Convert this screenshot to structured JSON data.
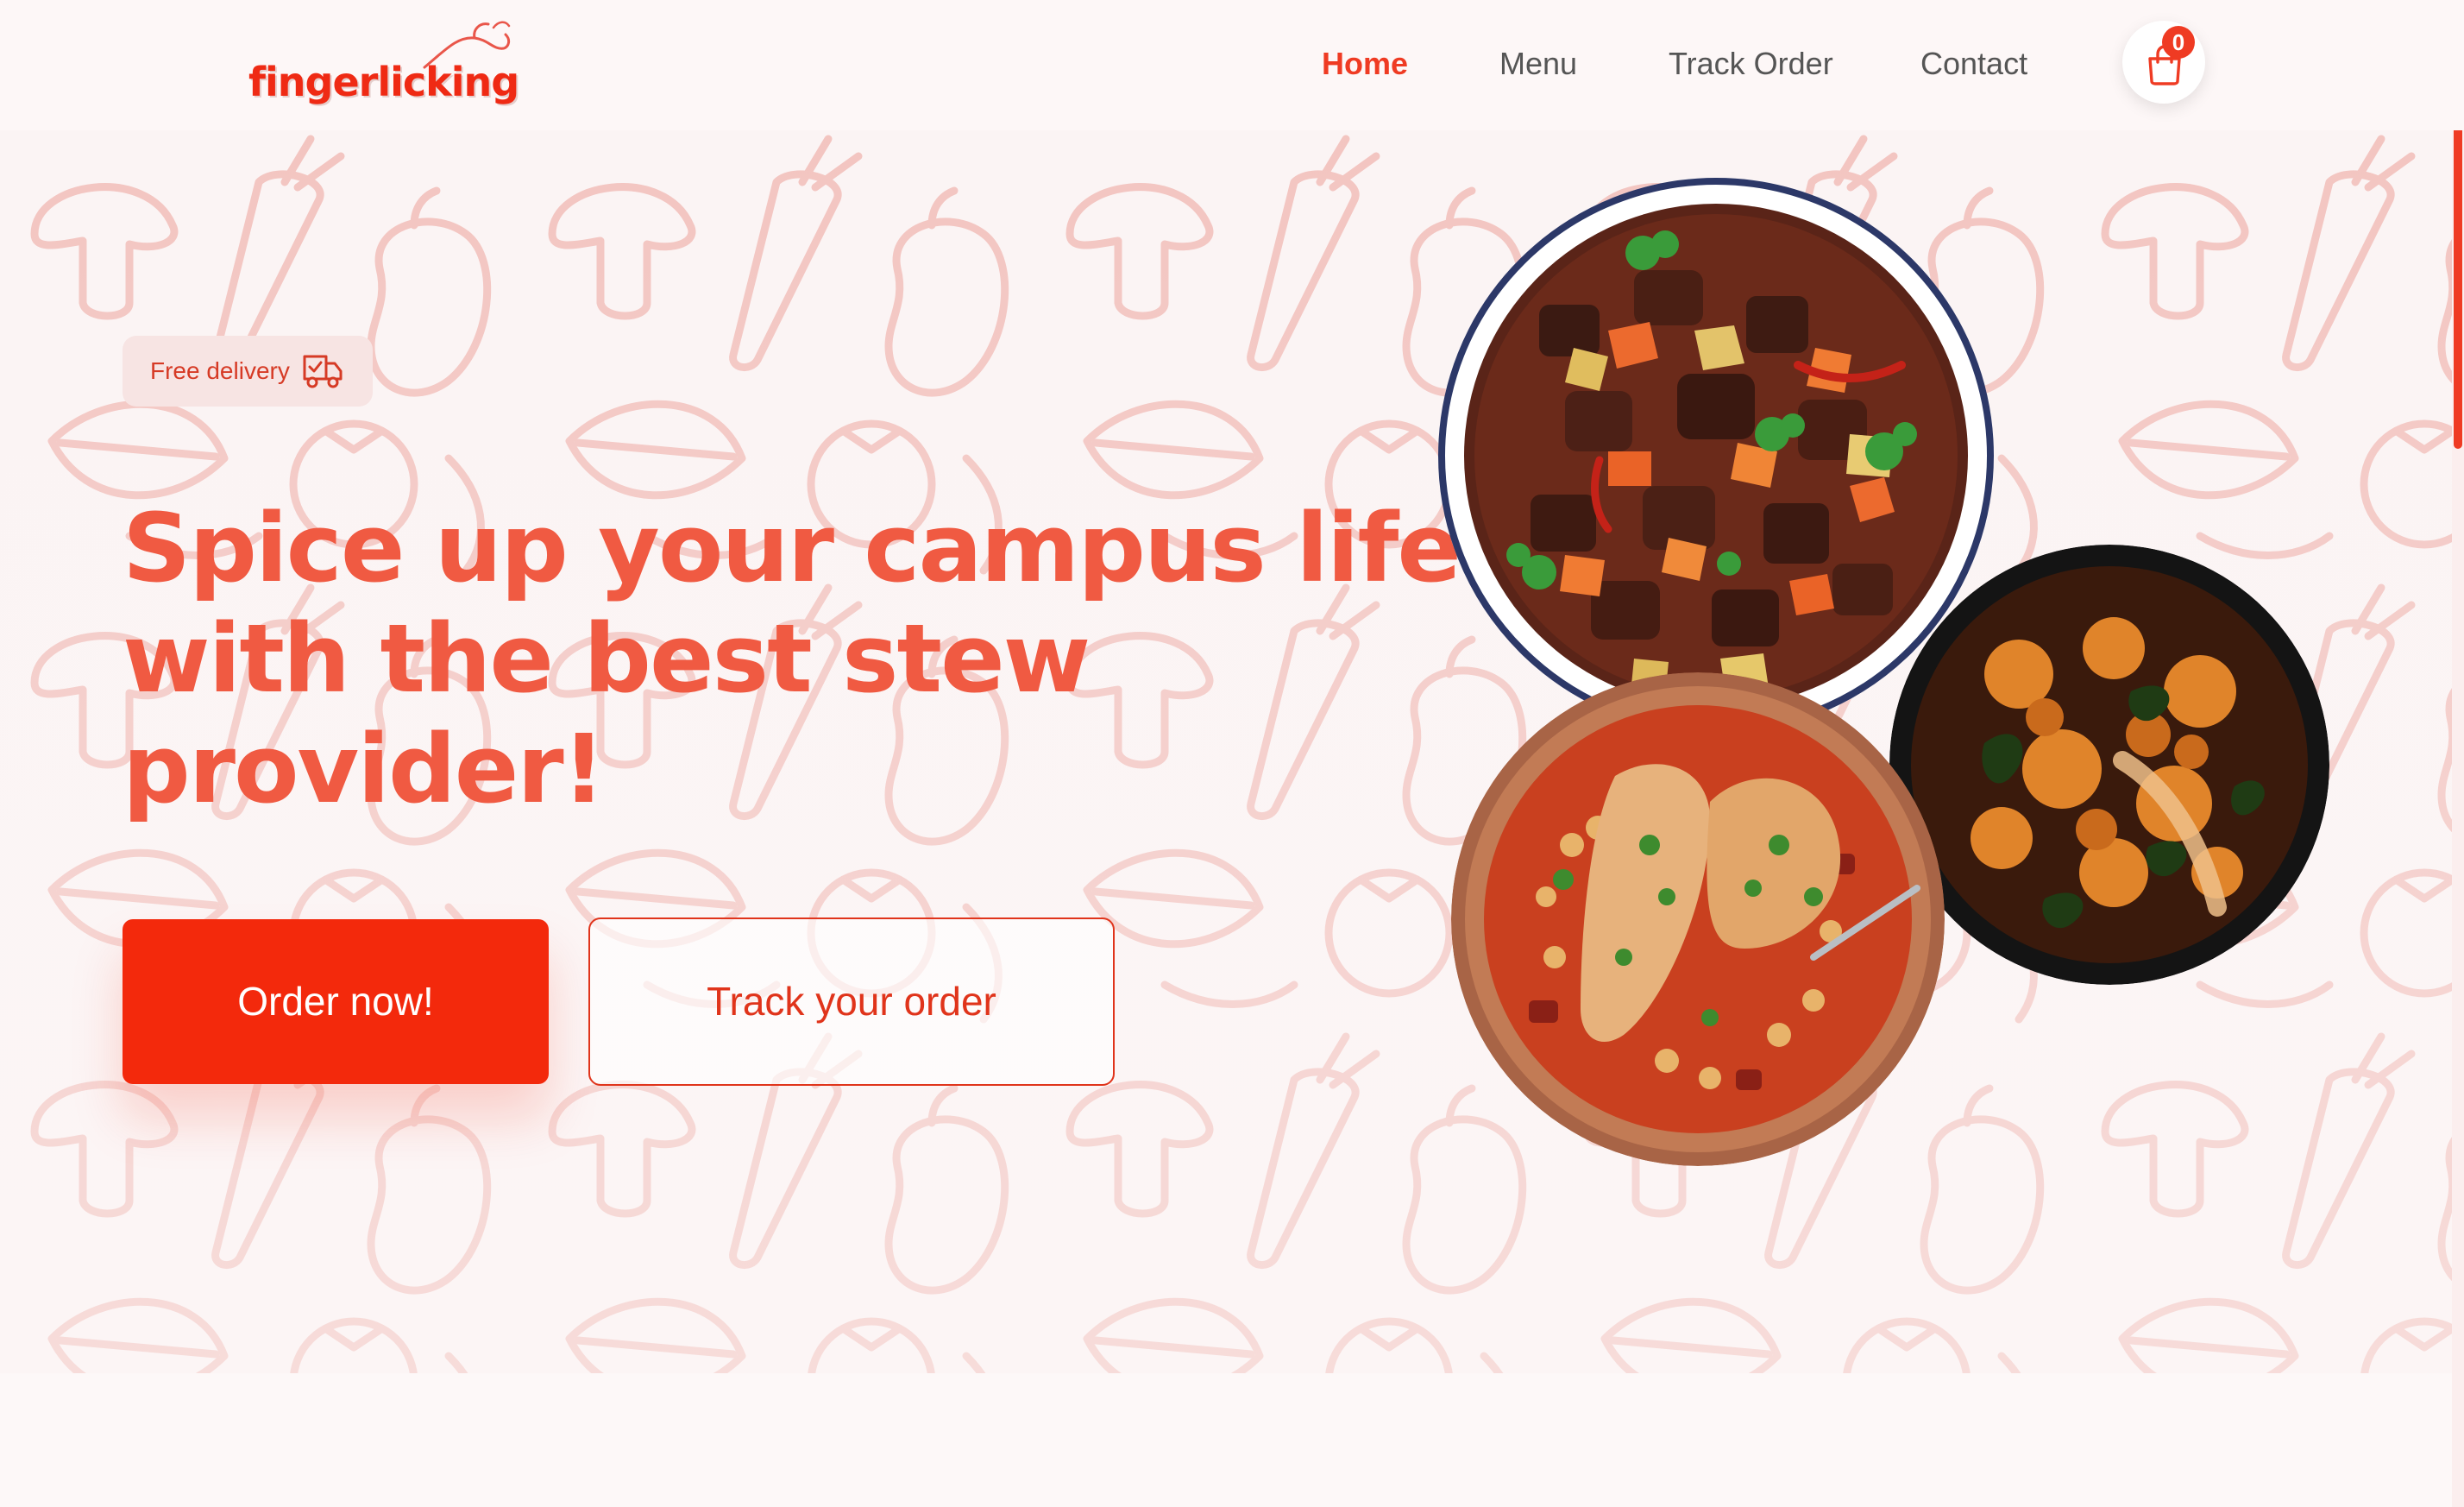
{
  "brand": {
    "logo_text": "fingerlicking"
  },
  "nav": {
    "links": [
      {
        "label": "Home",
        "active": true
      },
      {
        "label": "Menu",
        "active": false
      },
      {
        "label": "Track Order",
        "active": false
      },
      {
        "label": "Contact",
        "active": false
      }
    ],
    "cart_count": "0"
  },
  "hero": {
    "badge": "Free delivery",
    "headline": [
      "Spice up your campus life!",
      "with the best stew",
      "provider!"
    ],
    "primary_button": "Order now!",
    "secondary_button": "Track your order"
  },
  "colors": {
    "accent": "#ef3b23",
    "primary_button": "#f3290c",
    "headline": "#f05a42",
    "pattern": "#f0b8b4"
  },
  "icons": [
    "truck-check-icon",
    "shopping-bag-icon",
    "scroll-thumb"
  ]
}
